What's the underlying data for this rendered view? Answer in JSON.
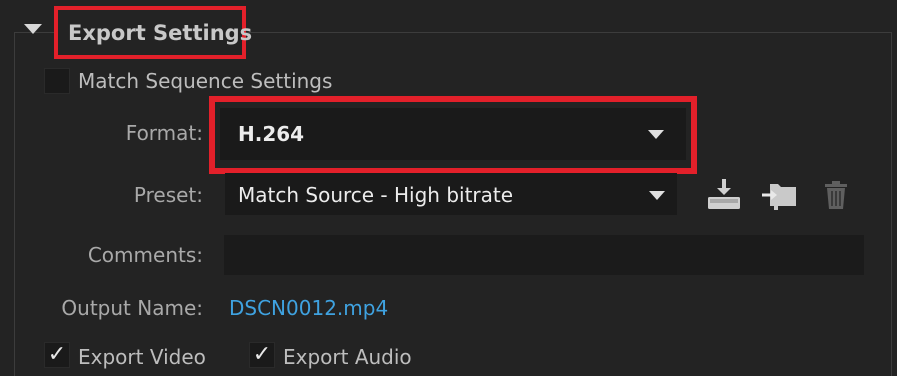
{
  "section": {
    "title": "Export Settings",
    "expanded_icon": "disclosure-triangle-down"
  },
  "match_sequence": {
    "label": "Match Sequence Settings",
    "checked": false
  },
  "format": {
    "label": "Format:",
    "value": "H.264"
  },
  "preset": {
    "label": "Preset:",
    "value": "Match Source - High bitrate",
    "icons": [
      "save-preset-icon",
      "import-preset-icon",
      "delete-preset-icon"
    ]
  },
  "comments": {
    "label": "Comments:",
    "value": ""
  },
  "output_name": {
    "label": "Output Name:",
    "value": "DSCN0012.mp4"
  },
  "export_video": {
    "label": "Export Video",
    "checked": true,
    "check_glyph": "✓"
  },
  "export_audio": {
    "label": "Export Audio",
    "checked": true,
    "check_glyph": "✓"
  },
  "colors": {
    "highlight": "#e3202a",
    "link": "#3fa2e0",
    "background": "#232323"
  }
}
